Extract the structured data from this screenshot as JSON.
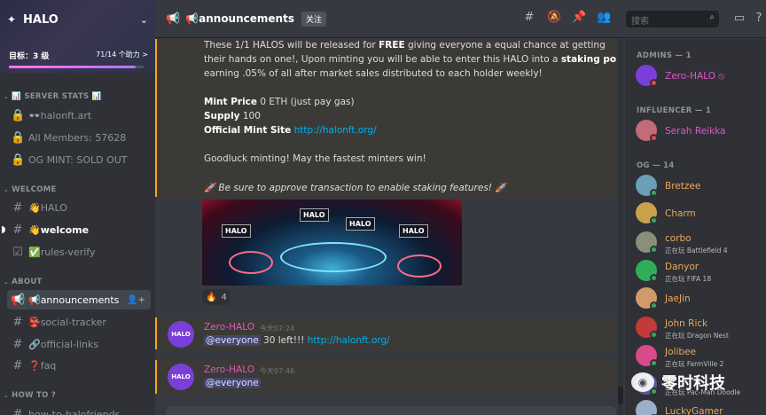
{
  "server": {
    "name": "HALO",
    "boost_goal": "目标：3 级",
    "boost_count": "71/14 个助力 >",
    "boost_progress": 0.94
  },
  "sidebar": {
    "categories": {
      "server_stats": "📊 SERVER STATS 📊",
      "welcome": "WELCOME",
      "about": "ABOUT",
      "how_to": "HOW TO ?"
    },
    "stats": [
      {
        "icon": "lock-icon",
        "label": "👓halonft.art"
      },
      {
        "icon": "lock-icon",
        "label": "All Members: 57628"
      },
      {
        "icon": "lock-icon",
        "label": "OG MINT: SOLD OUT"
      }
    ],
    "welcome": [
      {
        "label": "👋HALO"
      },
      {
        "label": "👋welcome"
      },
      {
        "label": "✅rules-verify"
      }
    ],
    "about": [
      {
        "label": "📢announcements"
      },
      {
        "label": "👺social-tracker"
      },
      {
        "label": "🔗official-links"
      },
      {
        "label": "❓faq"
      }
    ],
    "how_to": [
      {
        "label": "how-to-halofriends"
      }
    ]
  },
  "topbar": {
    "channel": "📢announcements",
    "follow": "关注",
    "search_placeholder": "搜索"
  },
  "chat": {
    "announcement": {
      "line1": "These 1/1 HALOS will be released for ",
      "line1_bold": "FREE",
      "line1_end": " giving everyone a equal chance at getting",
      "line2": "their hands on one!, Upon minting you will be able to enter this HALO into a ",
      "line2_bold": "staking pool",
      "line3": " earning .05% of all after market sales distributed to each holder weekly!",
      "mint_price_label": "Mint Price",
      "mint_price": " 0 ETH (just pay gas)",
      "supply_label": "Supply",
      "supply": " 100",
      "site_label": "Official Mint Site",
      "site_url": "http://halonft.org/",
      "goodluck": "Goodluck minting! May the fastest minters win!",
      "staking_note": "🚀 Be sure to approve transaction to enable staking features! 🚀",
      "image_signs": [
        "HALO",
        "HALO",
        "HALO",
        "HALO"
      ],
      "reaction_emoji": "🔥",
      "reaction_count": "4"
    },
    "messages": [
      {
        "author": "Zero-HALO",
        "time": "今天07:24",
        "mention": "@everyone",
        "text": " 30 left!!! ",
        "link": "http://halonft.org/",
        "avatar": "HALO"
      },
      {
        "author": "Zero-HALO",
        "time": "今天07:46",
        "mention": "@everyone",
        "text": "",
        "link": "",
        "avatar": "HALO"
      }
    ]
  },
  "members": {
    "admins_header": "ADMINS — 1",
    "influencer_header": "INFLUENCER — 1",
    "og_header": "OG — 14",
    "list": [
      {
        "name": "Zero-HALO ⦸",
        "activity": "",
        "color": "#e056c7",
        "avatar_color": "#7b3fd9",
        "status_color": "#ed4245"
      },
      {
        "name": "Serah Reikka",
        "activity": "",
        "color": "#e056c7",
        "avatar_color": "#c46a7a",
        "status_color": "#ed4245"
      },
      {
        "name": "Bretzee",
        "activity": "",
        "color": "#e8a85c",
        "avatar_color": "#6a9fb5",
        "status_color": "#3ba55d"
      },
      {
        "name": "Charm",
        "activity": "",
        "color": "#e8a85c",
        "avatar_color": "#c8a24a",
        "status_color": "#3ba55d"
      },
      {
        "name": "corbo",
        "activity": "正在玩 Battlefield 4",
        "color": "#e8a85c",
        "avatar_color": "#8a8f7a",
        "status_color": "#3ba55d"
      },
      {
        "name": "Danyor",
        "activity": "正在玩 FIFA 18",
        "color": "#e8a85c",
        "avatar_color": "#2fae5a",
        "status_color": "#3ba55d"
      },
      {
        "name": "JaeJin",
        "activity": "",
        "color": "#e8a85c",
        "avatar_color": "#d09a6a",
        "status_color": "#3ba55d"
      },
      {
        "name": "John Rick",
        "activity": "正在玩 Dragon Nest",
        "color": "#e8a85c",
        "avatar_color": "#c23a3a",
        "status_color": "#3ba55d"
      },
      {
        "name": "Jolibee",
        "activity": "正在玩 FarmVille 2",
        "color": "#e8a85c",
        "avatar_color": "#d94a8a",
        "status_color": "#3ba55d"
      },
      {
        "name": "",
        "activity": "正在玩 Pac-Man Doodle",
        "color": "#e8a85c",
        "avatar_color": "#5a5a9a",
        "status_color": "#3ba55d"
      },
      {
        "name": "LuckyGamer",
        "activity": "",
        "color": "#e8a85c",
        "avatar_color": "#9ab0c8",
        "status_color": "#3ba55d"
      }
    ]
  },
  "watermark": "零时科技"
}
